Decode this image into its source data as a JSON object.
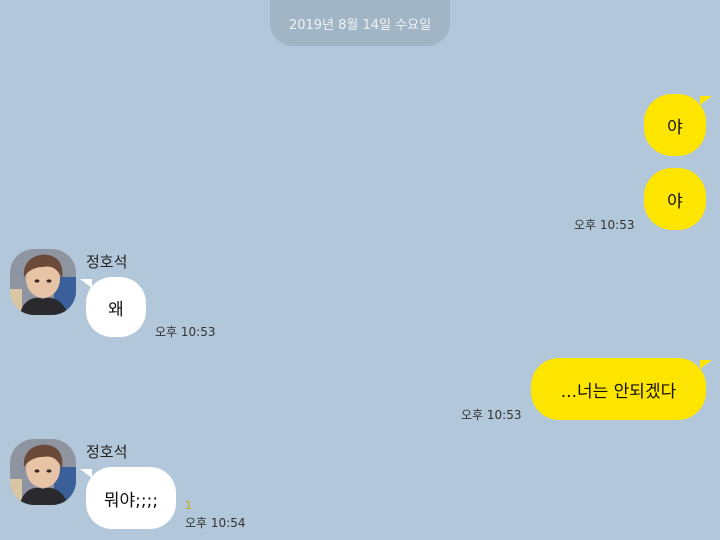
{
  "date_divider": "2019년 8월 14일 수요일",
  "messages": [
    {
      "side": "me",
      "text": "야"
    },
    {
      "side": "me",
      "text": "야",
      "time": "오후 10:53"
    },
    {
      "side": "them",
      "sender": "정호석",
      "text": "왜",
      "time": "오후 10:53"
    },
    {
      "side": "me",
      "text": "...너는 안되겠다",
      "time": "오후 10:53"
    },
    {
      "side": "them",
      "sender": "정호석",
      "text": "뭐야;;;;",
      "time": "오후 10:54",
      "unread": "1"
    }
  ],
  "colors": {
    "background": "#b2c7d9",
    "my_bubble": "#fee500",
    "their_bubble": "#ffffff"
  }
}
